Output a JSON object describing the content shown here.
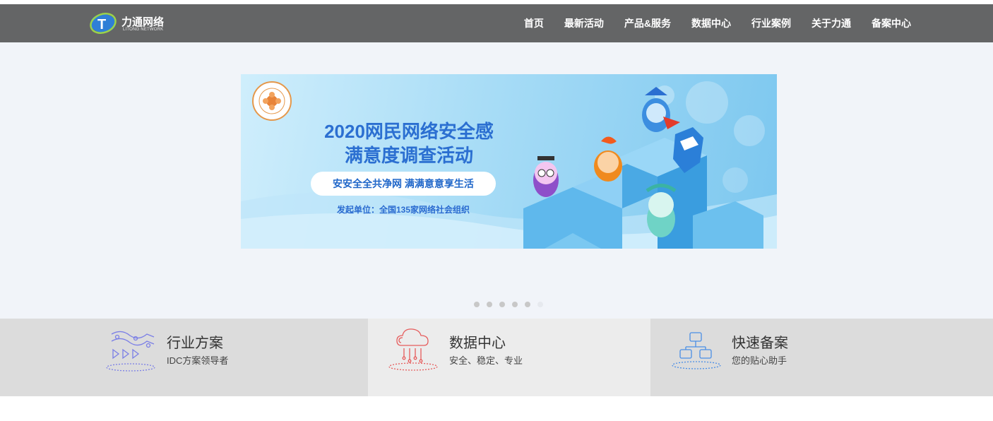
{
  "header": {
    "logo_text": "力通网络",
    "logo_sub": "LITONG NETWORK",
    "nav": [
      "首页",
      "最新活动",
      "产品&服务",
      "数据中心",
      "行业案例",
      "关于力通",
      "备案中心"
    ]
  },
  "banner": {
    "title_line1": "2020网民网络安全感",
    "title_line2": "满意度调查活动",
    "slogan": "安安全全共净网 满满意意享生活",
    "organizer": "发起单位：全国135家网络社会组织"
  },
  "carousel": {
    "total": 6,
    "active": 5
  },
  "features": [
    {
      "title": "行业方案",
      "subtitle": "IDC方案领导者",
      "icon": "industry-solution-icon",
      "bg": "#dcdcdc",
      "color": "#7b7fe6"
    },
    {
      "title": "数据中心",
      "subtitle": "安全、稳定、专业",
      "icon": "cloud-data-icon",
      "bg": "#ececec",
      "color": "#e65c5c"
    },
    {
      "title": "快速备案",
      "subtitle": "您的贴心助手",
      "icon": "network-nodes-icon",
      "bg": "#dcdcdc",
      "color": "#4a8ee6"
    }
  ],
  "colors": {
    "header_bg": "#646566",
    "hero_bg": "#f1f4f9"
  }
}
